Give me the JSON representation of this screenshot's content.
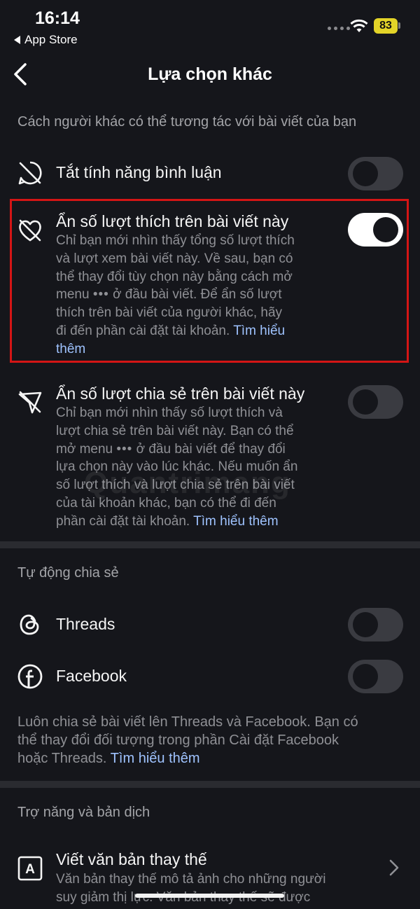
{
  "status": {
    "time": "16:14",
    "back_app": "App Store",
    "battery": "83"
  },
  "nav": {
    "title": "Lựa chọn khác",
    "back_icon": "chevron-left-icon"
  },
  "sections": {
    "interaction_header": "Cách người khác có thể tương tác với bài viết của bạn",
    "autoshare_header": "Tự động chia sẻ",
    "accessibility_header": "Trợ năng và bản dịch"
  },
  "comments": {
    "title": "Tắt tính năng bình luận",
    "icon": "comment-off-icon",
    "toggle_on": false
  },
  "hide_likes": {
    "title": "Ẩn số lượt thích trên bài viết này",
    "desc_lines": [
      "Chỉ bạn mới nhìn thấy tổng số lượt thích",
      "và lượt xem bài viết này. Về sau, bạn có",
      "thể thay đổi tùy chọn này bằng cách mở",
      "menu",
      "ở đầu bài viết. Để ẩn số lượt",
      "thích trên bài viết của người khác, hãy",
      "đi đến phần cài đặt tài khoản."
    ],
    "dots": "•••",
    "link_1": "Tìm hiểu",
    "link_2": "thêm",
    "icon": "heart-off-icon",
    "toggle_on": true
  },
  "hide_shares": {
    "title": "Ẩn số lượt chia sẻ trên bài viết này",
    "desc_lines": [
      "Chỉ bạn mới nhìn thấy số lượt thích và",
      "lượt chia sẻ trên bài viết này. Bạn có thể",
      "mở menu",
      "ở đầu bài viết để thay đổi",
      "lựa chọn này vào lúc khác. Nếu muốn ẩn",
      "số lượt thích và lượt chia sẻ trên bài viết",
      "của tài khoản khác, bạn có thể đi đến",
      "phần cài đặt tài khoản."
    ],
    "dots": "•••",
    "link": "Tìm hiểu thêm",
    "icon": "share-off-icon",
    "toggle_on": false
  },
  "threads": {
    "title": "Threads",
    "icon": "threads-icon",
    "toggle_on": false
  },
  "facebook": {
    "title": "Facebook",
    "icon": "facebook-icon",
    "toggle_on": false
  },
  "autoshare_note": {
    "lines": [
      "Luôn chia sẻ bài viết lên Threads và Facebook. Bạn có",
      "thể thay đổi đối tượng trong phần Cài đặt Facebook",
      "hoặc Threads."
    ],
    "link": "Tìm hiểu thêm"
  },
  "alt_text": {
    "title": "Viết văn bản thay thế",
    "desc_lines": [
      "Văn bản thay thế mô tả ảnh cho những người",
      "suy giảm thị lực. Văn bản thay thế sẽ được"
    ],
    "icon": "alt-text-icon"
  },
  "watermark": "Quantrimang",
  "colors": {
    "background": "#15161b",
    "accent_link": "#9fc3ff",
    "highlight": "#d41515",
    "battery": "#e3d428"
  }
}
